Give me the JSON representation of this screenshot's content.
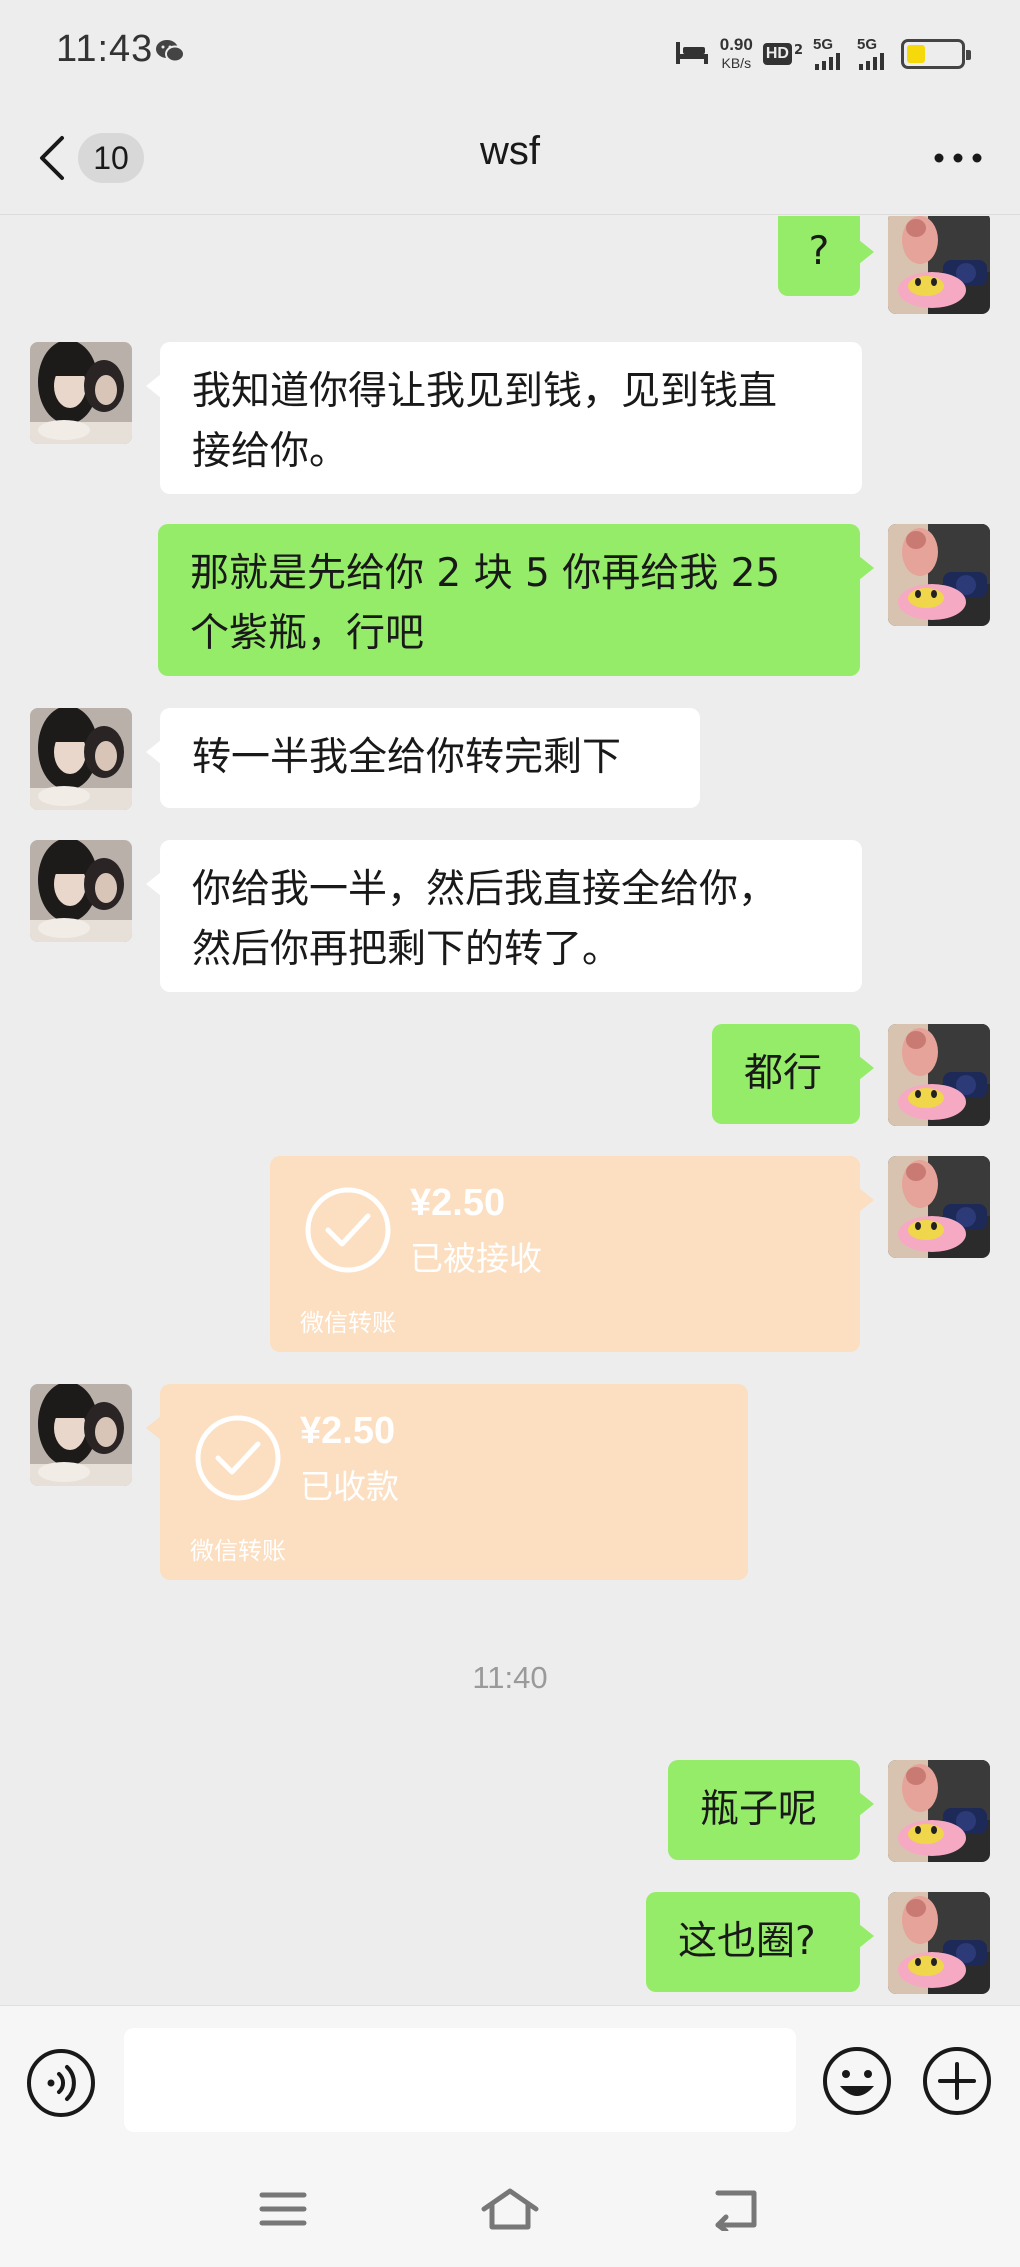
{
  "status_bar": {
    "time": "11:43",
    "net_speed_value": "0.90",
    "net_speed_unit": "KB/s",
    "hd_label": "HD",
    "hd_sub": "2",
    "signal1_label": "5G",
    "signal2_label": "5G",
    "battery_level": 0.35,
    "battery_color": "#f5d90a"
  },
  "nav": {
    "unread_count": "10",
    "title": "wsf"
  },
  "messages": [
    {
      "side": "out",
      "text": "?"
    },
    {
      "side": "in",
      "line1": "我知道你得让我见到钱，见到钱直",
      "line2": "接给你。"
    },
    {
      "side": "out",
      "line1": "那就是先给你 2 块 5 你再给我 25",
      "line2": "个紫瓶，行吧"
    },
    {
      "side": "in",
      "text": "转一半我全给你转完剩下"
    },
    {
      "side": "in",
      "line1": "你给我一半，然后我直接全给你，",
      "line2": "然后你再把剩下的转了。"
    },
    {
      "side": "out",
      "text": "都行"
    },
    {
      "side": "out",
      "type": "transfer",
      "amount": "¥2.50",
      "status": "已被接收",
      "label": "微信转账"
    },
    {
      "side": "in",
      "type": "transfer",
      "amount": "¥2.50",
      "status": "已收款",
      "label": "微信转账"
    },
    {
      "type": "time",
      "text": "11:40"
    },
    {
      "side": "out",
      "text": "瓶子呢"
    },
    {
      "side": "out",
      "text": "这也圈?"
    }
  ],
  "input_bar": {
    "placeholder": ""
  },
  "colors": {
    "outgoing_bubble": "#95ec69",
    "incoming_bubble": "#ffffff",
    "transfer_bubble": "#fcdec0",
    "background": "#ededed"
  },
  "icons": {
    "back": "chevron-left-icon",
    "more": "more-dots-icon",
    "voice": "voice-icon",
    "emoji": "emoji-icon",
    "plus": "plus-icon",
    "check": "check-circle-icon",
    "menu": "menu-icon",
    "home": "home-icon",
    "return": "return-icon"
  }
}
